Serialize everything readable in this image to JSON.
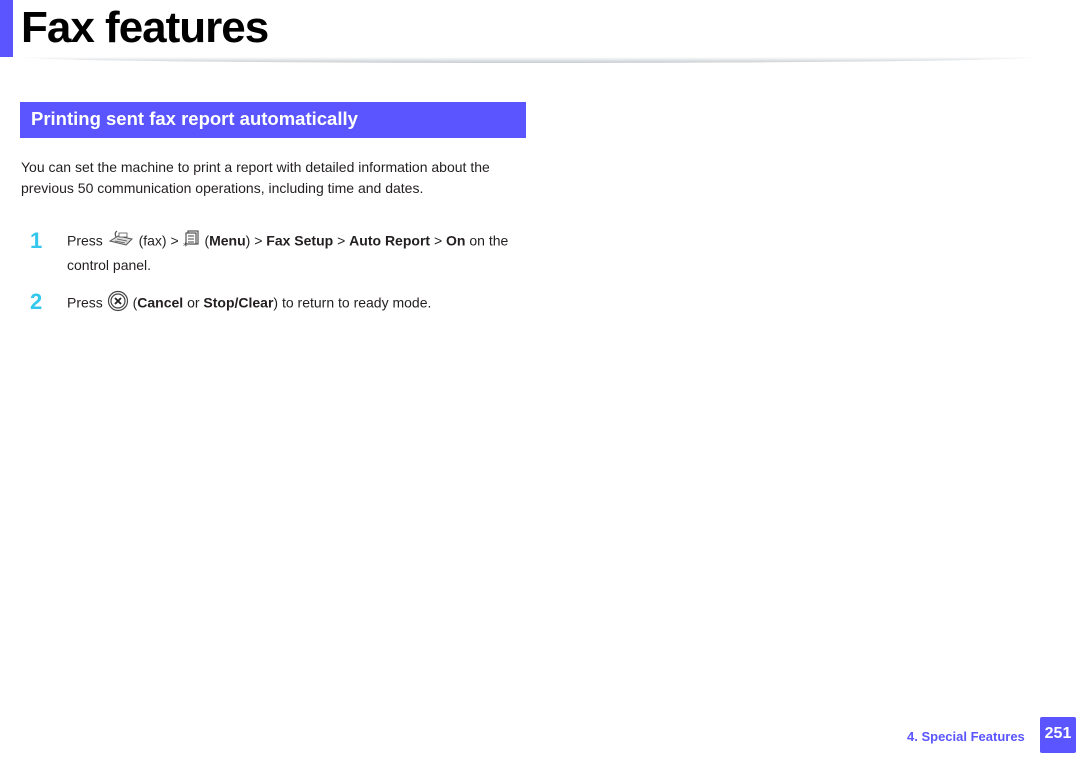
{
  "page": {
    "title": "Fax features",
    "accent_color": "#5a55ff",
    "step_number_color": "#33c7ee"
  },
  "section": {
    "heading": "Printing sent fax report automatically",
    "intro": "You can set the machine to print a report with detailed information about the previous 50 communication operations, including time and dates."
  },
  "steps": [
    {
      "number": "1",
      "press": "Press",
      "fax_icon": "fax-icon",
      "fax_label": "(fax) >",
      "menu_icon": "menu-icon",
      "menu_open": "(",
      "menu_label": "Menu",
      "menu_close": ") >",
      "fax_setup": "Fax Setup",
      "sep1": ">",
      "auto_report": "Auto Report",
      "sep2": ">",
      "on": "On",
      "tail": "on the control panel."
    },
    {
      "number": "2",
      "press": "Press",
      "cancel_icon": "cancel-icon",
      "open": "(",
      "cancel": "Cancel",
      "or": "or",
      "stop_clear": "Stop/Clear",
      "tail": ") to return to ready mode."
    }
  ],
  "footer": {
    "chapter": "4.  Special Features",
    "page_number": "251"
  }
}
